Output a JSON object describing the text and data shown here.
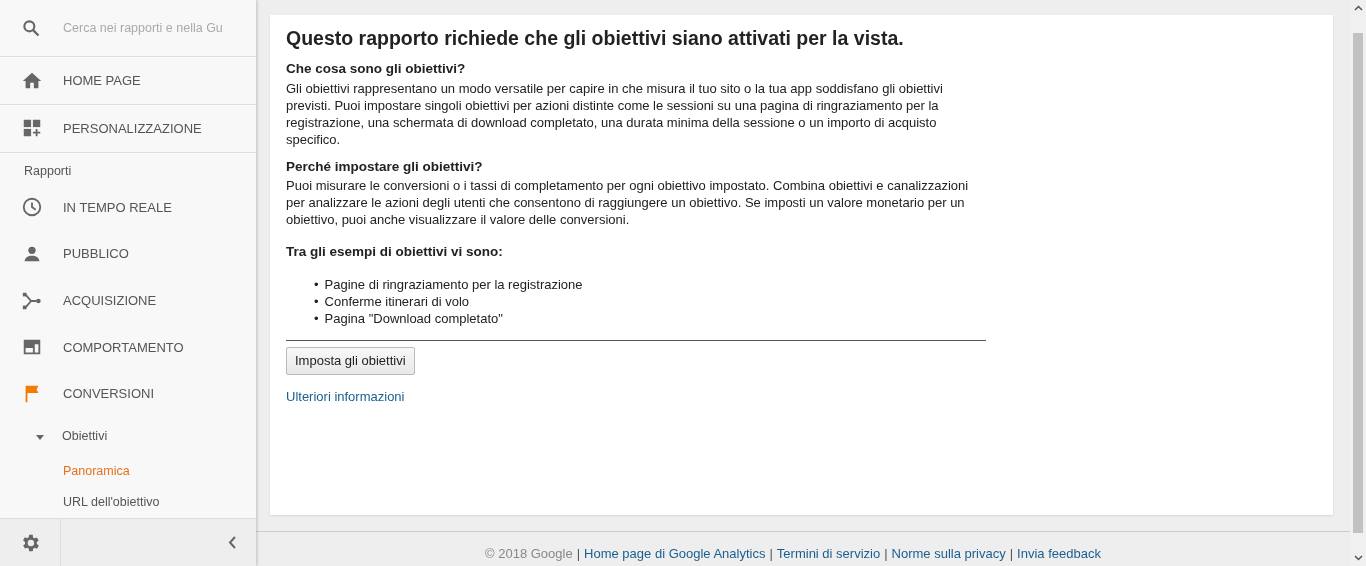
{
  "sidebar": {
    "search": {
      "placeholder": "Cerca nei rapporti e nella Gu"
    },
    "top_items": [
      {
        "label": "HOME PAGE"
      },
      {
        "label": "PERSONALIZZAZIONE"
      }
    ],
    "section_label": "Rapporti",
    "report_items": [
      {
        "label": "IN TEMPO REALE",
        "selected": false
      },
      {
        "label": "PUBBLICO",
        "selected": false
      },
      {
        "label": "ACQUISIZIONE",
        "selected": false
      },
      {
        "label": "COMPORTAMENTO",
        "selected": false
      },
      {
        "label": "CONVERSIONI",
        "selected": true
      }
    ],
    "subgroup": {
      "label": "Obiettivi",
      "expanded": true,
      "children": [
        {
          "label": "Panoramica",
          "selected": true
        },
        {
          "label": "URL dell'obiettivo",
          "selected": false
        }
      ]
    }
  },
  "content": {
    "title": "Questo rapporto richiede che gli obiettivi siano attivati per la vista.",
    "sections": [
      {
        "heading": "Che cosa sono gli obiettivi?",
        "text": "Gli obiettivi rappresentano un modo versatile per capire in che misura il tuo sito o la tua app soddisfano gli obiettivi previsti. Puoi impostare singoli obiettivi per azioni distinte come le sessioni su una pagina di ringraziamento per la registrazione, una schermata di download completato, una durata minima della sessione o un importo di acquisto specifico."
      },
      {
        "heading": "Perché impostare gli obiettivi?",
        "text": "Puoi misurare le conversioni o i tassi di completamento per ogni obiettivo impostato. Combina obiettivi e canalizzazioni per analizzare le azioni degli utenti che consentono di raggiungere un obiettivo. Se imposti un valore monetario per un obiettivo, puoi anche visualizzare il valore delle conversioni."
      }
    ],
    "examples_heading": "Tra gli esempi di obiettivi vi sono:",
    "examples": [
      {
        "bullet": "•",
        "text": "Pagine di ringraziamento per la registrazione"
      },
      {
        "bullet": "•",
        "text": "Conferme itinerari di volo"
      },
      {
        "bullet": "•",
        "text": "Pagina \"Download completato\""
      }
    ],
    "button": "Imposta gli obiettivi",
    "link": "Ulteriori informazioni"
  },
  "footer": [
    {
      "kind": "text",
      "text": "© 2018 Google"
    },
    {
      "kind": "separator",
      "text": "|"
    },
    {
      "kind": "link",
      "text": "Home page di Google Analytics"
    },
    {
      "kind": "separator",
      "text": "|"
    },
    {
      "kind": "link",
      "text": "Termini di servizio"
    },
    {
      "kind": "separator",
      "text": "|"
    },
    {
      "kind": "link",
      "text": "Norme sulla privacy"
    },
    {
      "kind": "separator",
      "text": "|"
    },
    {
      "kind": "link",
      "text": "Invia feedback"
    }
  ]
}
